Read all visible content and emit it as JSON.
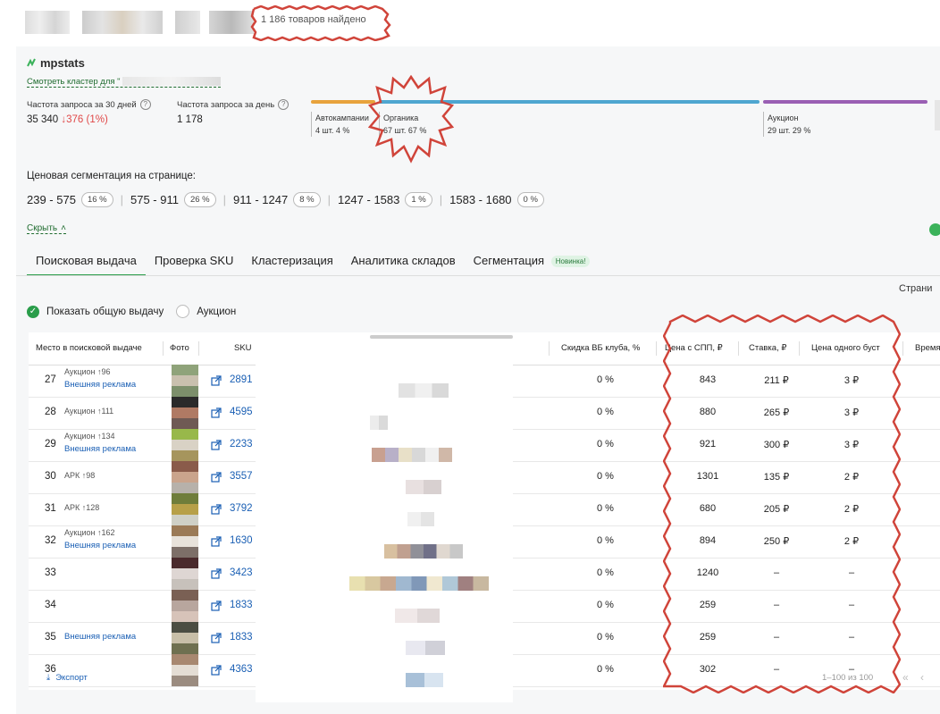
{
  "header": {
    "found_text": "1 186 товаров найдено"
  },
  "brand": {
    "name": "mpstats"
  },
  "cluster_link": "Смотреть кластер для \"",
  "stats": {
    "freq30_label": "Частота запроса за 30 дней",
    "freq30_value": "35 340",
    "freq30_delta": "↓376 (1%)",
    "freqday_label": "Частота запроса за день",
    "freqday_value": "1 178"
  },
  "segments": [
    {
      "name": "Автокампании",
      "info": "4 шт. 4 %",
      "color": "#e8a33c"
    },
    {
      "name": "Органика",
      "info": "67 шт. 67 %",
      "color": "#4ea6d0"
    },
    {
      "name": "Аукцион",
      "info": "29 шт. 29 %",
      "color": "#9a5fb4"
    }
  ],
  "price_segmentation": {
    "title": "Ценовая сегментация на странице:",
    "ranges": [
      {
        "range": "239 - 575",
        "pct": "16 %"
      },
      {
        "range": "575 - 911",
        "pct": "26 %"
      },
      {
        "range": "911 - 1247",
        "pct": "8 %"
      },
      {
        "range": "1247 - 1583",
        "pct": "1 %"
      },
      {
        "range": "1583 - 1680",
        "pct": "0 %"
      }
    ],
    "hide_label": "Скрыть"
  },
  "tabs": [
    {
      "label": "Поисковая выдача",
      "active": true
    },
    {
      "label": "Проверка SKU"
    },
    {
      "label": "Кластеризация"
    },
    {
      "label": "Аналитика складов"
    },
    {
      "label": "Сегментация",
      "badge": "Новинка!"
    }
  ],
  "pages_label": "Страни",
  "filters": {
    "show_all": "Показать общую выдачу",
    "auction": "Аукцион"
  },
  "table": {
    "headers": {
      "place": "Место в поисковой выдаче",
      "photo": "Фото",
      "sku": "SKU",
      "club": "Скидка ВБ клуба, %",
      "price": "Цена с СПП, ₽",
      "bid": "Ставка, ₽",
      "boost": "Цена одного буст",
      "time": "Время"
    },
    "rows": [
      {
        "place": "27",
        "auction": "Аукцион ↑96",
        "ad": "Внешняя реклама",
        "sku": "2891",
        "club": "0 %",
        "price": "843",
        "bid": "211 ₽",
        "boost": "3 ₽"
      },
      {
        "place": "28",
        "auction": "Аукцион ↑111",
        "ad": "",
        "sku": "4595",
        "club": "0 %",
        "price": "880",
        "bid": "265 ₽",
        "boost": "3 ₽"
      },
      {
        "place": "29",
        "auction": "Аукцион ↑134",
        "ad": "Внешняя реклама",
        "sku": "2233",
        "club": "0 %",
        "price": "921",
        "bid": "300 ₽",
        "boost": "3 ₽"
      },
      {
        "place": "30",
        "auction": "АРК ↑98",
        "ad": "",
        "sku": "3557",
        "club": "0 %",
        "price": "1301",
        "bid": "135 ₽",
        "boost": "2 ₽"
      },
      {
        "place": "31",
        "auction": "АРК ↑128",
        "ad": "",
        "sku": "3792",
        "club": "0 %",
        "price": "680",
        "bid": "205 ₽",
        "boost": "2 ₽"
      },
      {
        "place": "32",
        "auction": "Аукцион ↑162",
        "ad": "Внешняя реклама",
        "sku": "1630",
        "club": "0 %",
        "price": "894",
        "bid": "250 ₽",
        "boost": "2 ₽"
      },
      {
        "place": "33",
        "auction": "",
        "ad": "",
        "sku": "3423",
        "club": "0 %",
        "price": "1240",
        "bid": "–",
        "boost": "–"
      },
      {
        "place": "34",
        "auction": "",
        "ad": "",
        "sku": "1833",
        "club": "0 %",
        "price": "259",
        "bid": "–",
        "boost": "–"
      },
      {
        "place": "35",
        "auction": "",
        "ad": "Внешняя реклама",
        "sku": "1833",
        "club": "0 %",
        "price": "259",
        "bid": "–",
        "boost": "–"
      },
      {
        "place": "36",
        "auction": "",
        "ad": "",
        "sku": "4363",
        "club": "0 %",
        "price": "302",
        "bid": "–",
        "boost": "–"
      }
    ],
    "export_label": "Экспорт",
    "pager_text": "1–100 из 100"
  }
}
